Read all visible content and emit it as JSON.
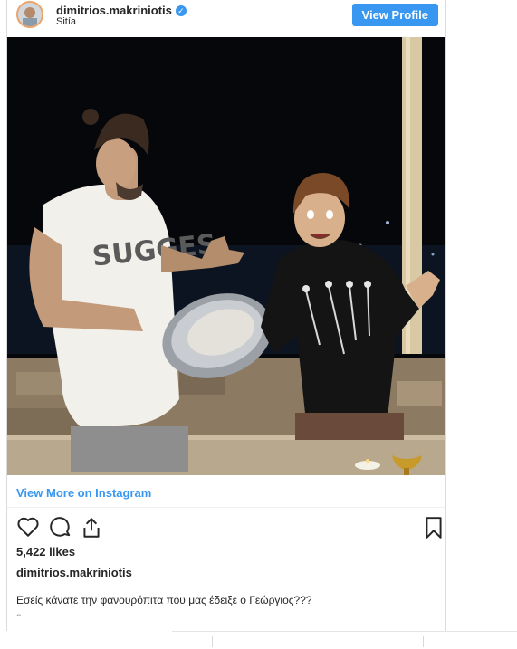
{
  "header": {
    "username": "dimitrios.makriniotis",
    "location": "Sitía",
    "view_profile_label": "View Profile"
  },
  "post": {
    "view_more_label": "View More on Instagram",
    "likes": "5,422 likes",
    "caption_username": "dimitrios.makriniotis",
    "caption_text": "Εσείς κάνατε την φανουρόπιτα που μας έδειξε ο Γεώργιος???",
    "caption_overflow": "ε"
  },
  "icons": {
    "like": "heart-icon",
    "comment": "comment-icon",
    "share": "share-icon",
    "save": "bookmark-icon",
    "verified": "verified-badge-icon"
  },
  "colors": {
    "accent": "#3897f0",
    "text": "#262626",
    "border": "#dbdbdb"
  }
}
